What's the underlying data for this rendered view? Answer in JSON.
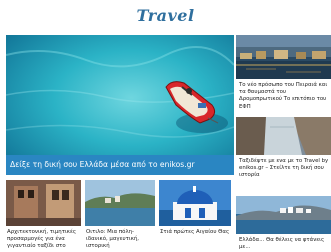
{
  "header": {
    "logo_text": "Travel"
  },
  "hero": {
    "caption": "Δείξε τη δική σου Ελλάδα μέσα από το enikos.gr",
    "image_alt": "red boat on turquoise sea"
  },
  "side_articles": [
    {
      "title": "Το νέο πρόσωπο του Πειραιά και τα θαυμαστά του Δρομοπρωτικού Το επιτόπιο του ΕΦΠ"
    },
    {
      "title": "Ταξιδέψτε με ενα με το Travel by enikos.gr – Στείλτε τη δική σου ιστορία"
    },
    {
      "title": "Ελλάδα... Θα θέλεις να φτάνεις με..."
    }
  ],
  "bottom_articles": [
    {
      "title": "Αρχιτεκτονική, τιμητικές προσαρμογές για ένα γιγαντιαίο ταξίδι στο"
    },
    {
      "title": "Οιτιλο: Μια πόλη-ιδανικό, μαγευτική, ιστορική"
    },
    {
      "title": "Στιά πρώτες Αιγαίου Θας"
    }
  ],
  "colors": {
    "accent": "#2a86c2",
    "logo": "#2f6f9e"
  }
}
